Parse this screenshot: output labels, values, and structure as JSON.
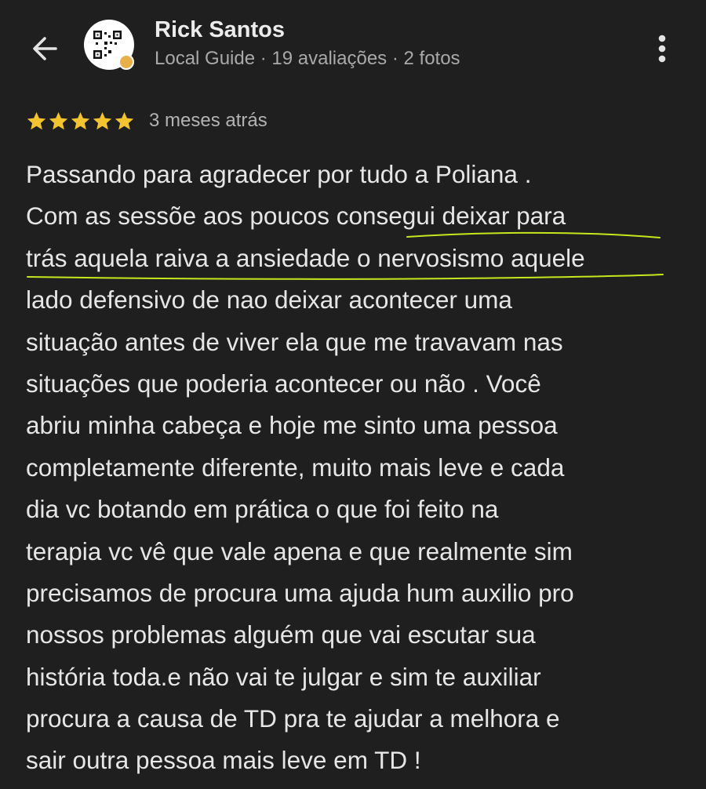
{
  "header": {
    "back_icon": "arrow-left-icon",
    "avatar_icon": "qr-code-icon",
    "user_name": "Rick Santos",
    "user_meta": "Local Guide · 19 avaliações · 2 fotos",
    "more_icon": "more-vert-icon"
  },
  "review": {
    "rating": 5,
    "rating_max": 5,
    "star_color": "#f4c430",
    "date": "3 meses atrás",
    "highlight_color": "#c8e61e",
    "lines": [
      "Passando para agradecer por tudo a Poliana .",
      "Com as sessõe aos poucos consegui deixar para",
      "trás aquela raiva a ansiedade o nervosismo aquele",
      "lado defensivo de nao deixar acontecer uma",
      "situação antes de viver ela que me travavam nas",
      "situações que poderia acontecer ou não . Você",
      "abriu minha cabeça e hoje me sinto uma pessoa",
      "completamente diferente, muito mais leve e cada",
      "dia vc botando em prática o que foi feito na",
      "terapia vc vê que vale apena e que realmente sim",
      "precisamos de procura uma ajuda hum auxilio pro",
      "nossos problemas alguém que vai escutar sua",
      "história toda.e não vai te julgar e sim te auxiliar",
      "procura a causa de TD pra te ajudar a melhora e",
      "sair outra pessoa mais leve em TD !"
    ]
  }
}
